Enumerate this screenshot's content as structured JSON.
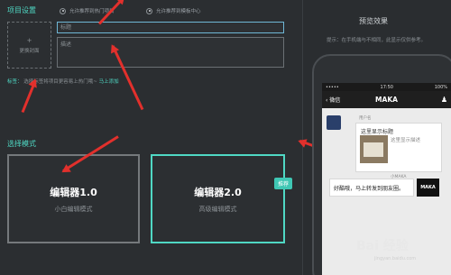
{
  "project": {
    "section_title": "项目设置",
    "radio_hot": "允许推荐到热门项目",
    "radio_template": "允许推荐到模板中心",
    "cover_label": "更换封面",
    "title_placeholder": "标题",
    "desc_placeholder": "描述",
    "note_label": "标签：",
    "note_text": "选择标签将项目更容易上热门哦~",
    "note_link": "马上添加"
  },
  "mode": {
    "section_title": "选择模式",
    "basic_name": "编辑器1.0",
    "basic_sub": "小白编辑模式",
    "adv_name": "编辑器2.0",
    "adv_sub": "高级编辑模式",
    "recommend_badge": "推荐"
  },
  "preview": {
    "title": "预览效果",
    "tip": "提示：在手机端与不相同，此显示仅供参考。",
    "status_left": "•••••",
    "status_time": "17:50",
    "status_right": "100%",
    "back_label": "微信",
    "nav_title": "MAKA",
    "user_name": "用户名",
    "card_title": "这里显示标题",
    "card_desc": "这里显示描述",
    "maka_name": "小MAKA",
    "maka_msg": "好酷哦，马上转发到朋友圈。",
    "maka_logo": "MAKA"
  },
  "watermark": {
    "brand": "Bai 经验",
    "url": "jingyan.baidu.com"
  },
  "colors": {
    "accent": "#4fd8c4",
    "arrow": "#e2302c",
    "background": "#2e3134"
  }
}
